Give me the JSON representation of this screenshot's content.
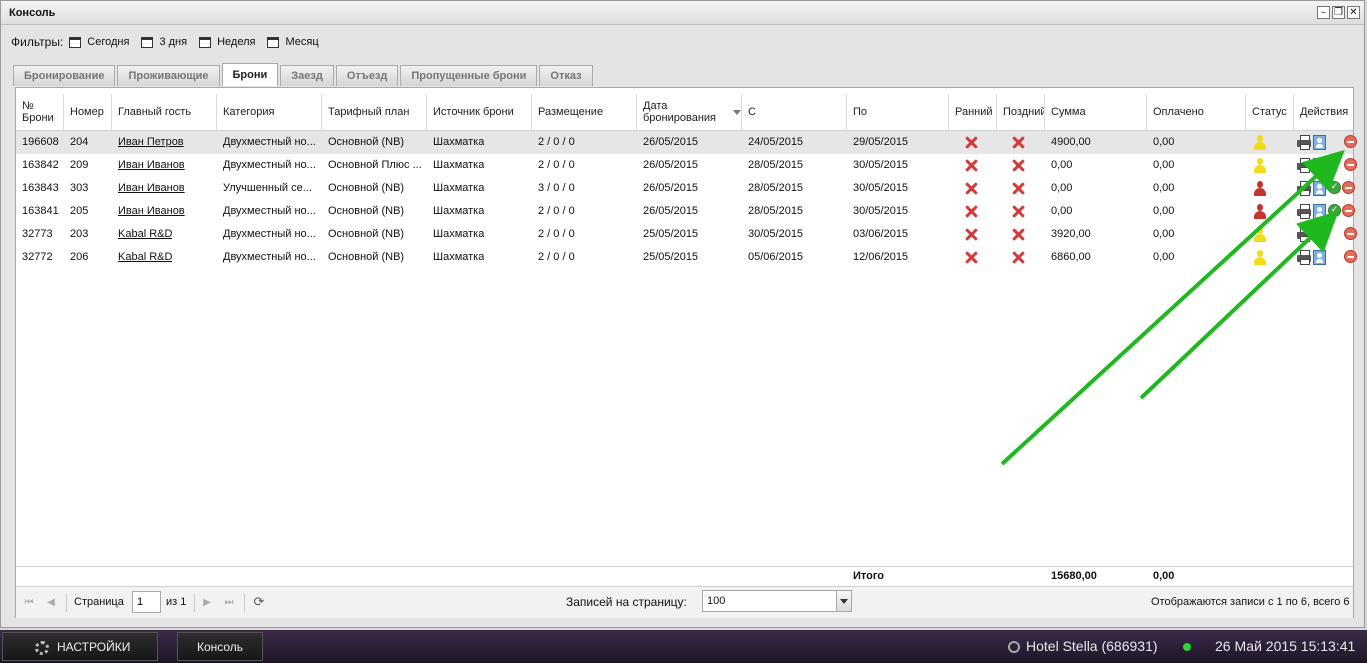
{
  "window": {
    "title": "Консоль"
  },
  "filters": {
    "label": "Фильтры:",
    "items": [
      "Сегодня",
      "3 дня",
      "Неделя",
      "Месяц"
    ]
  },
  "tabs": [
    {
      "label": "Бронирование"
    },
    {
      "label": "Проживающие"
    },
    {
      "label": "Брони"
    },
    {
      "label": "Заезд"
    },
    {
      "label": "Отъезд"
    },
    {
      "label": "Пропущенные брони"
    },
    {
      "label": "Отказ"
    }
  ],
  "active_tab": "Брони",
  "columns": {
    "num": "№ Брони",
    "room": "Номер",
    "guest": "Главный гость",
    "category": "Категория",
    "tariff": "Тарифный план",
    "source": "Источник брони",
    "placement": "Размещение",
    "booked": "Дата бронирования",
    "from": "С",
    "to": "По",
    "early": "Ранний з",
    "late": "Поздний",
    "sum": "Сумма",
    "paid": "Оплачено",
    "status": "Статус",
    "actions": "Действия"
  },
  "rows": [
    {
      "num": "196608",
      "room": "204",
      "guest": "Иван Петров",
      "category": "Двухместный но...",
      "tariff": "Основной (NB)",
      "source": "Шахматка",
      "placement": "2 / 0 / 0",
      "booked": "26/05/2015",
      "from": "24/05/2015",
      "to": "29/05/2015",
      "sum": "4900,00",
      "paid": "0,00",
      "status": "yellow",
      "checkin": false
    },
    {
      "num": "163842",
      "room": "209",
      "guest": "Иван Иванов",
      "category": "Двухместный но...",
      "tariff": "Основной Плюс ...",
      "source": "Шахматка",
      "placement": "2 / 0 / 0",
      "booked": "26/05/2015",
      "from": "28/05/2015",
      "to": "30/05/2015",
      "sum": "0,00",
      "paid": "0,00",
      "status": "yellow",
      "checkin": false
    },
    {
      "num": "163843",
      "room": "303",
      "guest": "Иван Иванов",
      "category": "Улучшенный се...",
      "tariff": "Основной (NB)",
      "source": "Шахматка",
      "placement": "3 / 0 / 0",
      "booked": "26/05/2015",
      "from": "28/05/2015",
      "to": "30/05/2015",
      "sum": "0,00",
      "paid": "0,00",
      "status": "red",
      "checkin": true
    },
    {
      "num": "163841",
      "room": "205",
      "guest": "Иван Иванов",
      "category": "Двухместный но...",
      "tariff": "Основной (NB)",
      "source": "Шахматка",
      "placement": "2 / 0 / 0",
      "booked": "26/05/2015",
      "from": "28/05/2015",
      "to": "30/05/2015",
      "sum": "0,00",
      "paid": "0,00",
      "status": "red",
      "checkin": true
    },
    {
      "num": "32773",
      "room": "203",
      "guest": "Kabal R&D",
      "category": "Двухместный но...",
      "tariff": "Основной (NB)",
      "source": "Шахматка",
      "placement": "2 / 0 / 0",
      "booked": "25/05/2015",
      "from": "30/05/2015",
      "to": "03/06/2015",
      "sum": "3920,00",
      "paid": "0,00",
      "status": "yellow",
      "checkin": false
    },
    {
      "num": "32772",
      "room": "206",
      "guest": "Kabal R&D",
      "category": "Двухместный но...",
      "tariff": "Основной (NB)",
      "source": "Шахматка",
      "placement": "2 / 0 / 0",
      "booked": "25/05/2015",
      "from": "05/06/2015",
      "to": "12/06/2015",
      "sum": "6860,00",
      "paid": "0,00",
      "status": "yellow",
      "checkin": false
    }
  ],
  "totals": {
    "label": "Итого",
    "sum": "15680,00",
    "paid": "0,00"
  },
  "pager": {
    "page_label": "Страница",
    "page_value": "1",
    "of_label": "из 1",
    "per_page_label": "Записей на страницу:",
    "per_page_value": "100",
    "summary": "Отображаются записи с 1 по 6, всего 6"
  },
  "taskbar": {
    "settings": "НАСТРОЙКИ",
    "console": "Консоль",
    "hotel": "Hotel Stella (686931)",
    "datetime": "26 Май 2015 15:13:41"
  },
  "colors": {
    "annotation_arrow": "#1fb81f",
    "cancel_x": "#d43a3a",
    "status_yellow": "#f2dc17",
    "status_red": "#c7322c"
  }
}
